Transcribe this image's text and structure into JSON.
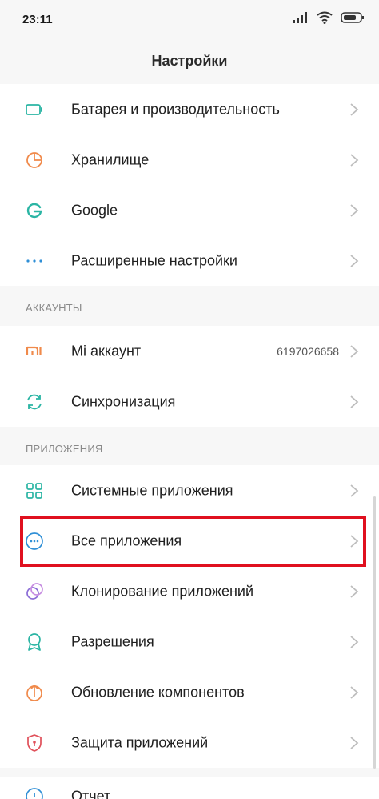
{
  "status_bar": {
    "time": "23:11",
    "icons": [
      "signal-icon",
      "wifi-icon",
      "battery-icon"
    ]
  },
  "header": {
    "title": "Настройки"
  },
  "group1": {
    "items": [
      {
        "label": "Батарея и производительность",
        "icon": "battery-icon",
        "color": "#2bb5a4"
      },
      {
        "label": "Хранилище",
        "icon": "storage-pie-icon",
        "color": "#f08a4b"
      },
      {
        "label": "Google",
        "icon": "google-icon",
        "color": "#2bb5a4"
      },
      {
        "label": "Расширенные настройки",
        "icon": "more-dots-icon",
        "color": "#2f8fd6"
      }
    ]
  },
  "accounts": {
    "header": "АККАУНТЫ",
    "items": [
      {
        "label": "Mi аккаунт",
        "value": "6197026658",
        "icon": "mi-icon",
        "color": "#f08a4b"
      },
      {
        "label": "Синхронизация",
        "icon": "sync-icon",
        "color": "#2bb5a4"
      }
    ]
  },
  "apps": {
    "header": "ПРИЛОЖЕНИЯ",
    "items": [
      {
        "label": "Системные приложения",
        "icon": "grid-icon",
        "color": "#2bb5a4"
      },
      {
        "label": "Все приложения",
        "icon": "circle-dots-icon",
        "color": "#2f8fd6"
      },
      {
        "label": "Клонирование приложений",
        "icon": "clone-icon",
        "color": "#8a6bd6"
      },
      {
        "label": "Разрешения",
        "icon": "award-icon",
        "color": "#2bb5a4"
      },
      {
        "label": "Обновление компонентов",
        "icon": "update-icon",
        "color": "#f08a4b"
      },
      {
        "label": "Защита приложений",
        "icon": "shield-icon",
        "color": "#e0505a"
      },
      {
        "label": "Отчет",
        "icon": "report-icon",
        "color": "#2f8fd6"
      }
    ]
  },
  "highlight_color": "#e0101f"
}
